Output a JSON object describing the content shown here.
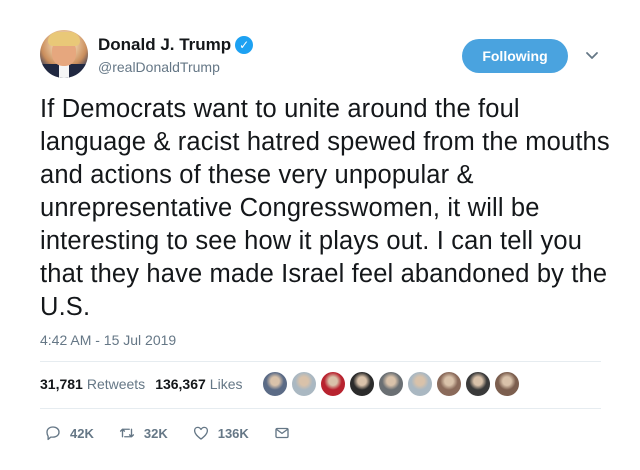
{
  "author": {
    "display_name": "Donald J. Trump",
    "handle": "@realDonaldTrump",
    "verified_icon": "verified-badge-icon"
  },
  "follow_button": {
    "label": "Following"
  },
  "tweet": {
    "text": "If Democrats want to unite around the foul language & racist hatred spewed from the mouths and actions of these very unpopular & unrepresentative Congresswomen, it will be interesting to see how it plays out. I can tell you that they have made Israel feel abandoned by the U.S.",
    "timestamp": "4:42 AM - 15 Jul 2019"
  },
  "stats": {
    "retweets_count": "31,781",
    "retweets_label": "Retweets",
    "likes_count": "136,367",
    "likes_label": "Likes"
  },
  "likers": [
    {
      "name": "liker-avatar-1",
      "color": "#5b6b86"
    },
    {
      "name": "liker-avatar-2",
      "color": "#aab8c2"
    },
    {
      "name": "liker-avatar-3",
      "color": "#b8232f"
    },
    {
      "name": "liker-avatar-4",
      "color": "#2b2b2b"
    },
    {
      "name": "liker-avatar-5",
      "color": "#6a6f73"
    },
    {
      "name": "liker-avatar-6",
      "color": "#aab8c2"
    },
    {
      "name": "liker-avatar-7",
      "color": "#8a6a5a"
    },
    {
      "name": "liker-avatar-8",
      "color": "#3a3a3a"
    },
    {
      "name": "liker-avatar-9",
      "color": "#7c5f4f"
    }
  ],
  "actions": {
    "reply_count": "42K",
    "retweet_count": "32K",
    "like_count": "136K"
  },
  "colors": {
    "accent": "#1da1f2",
    "follow_button": "#4aa3df",
    "secondary_text": "#657786"
  }
}
